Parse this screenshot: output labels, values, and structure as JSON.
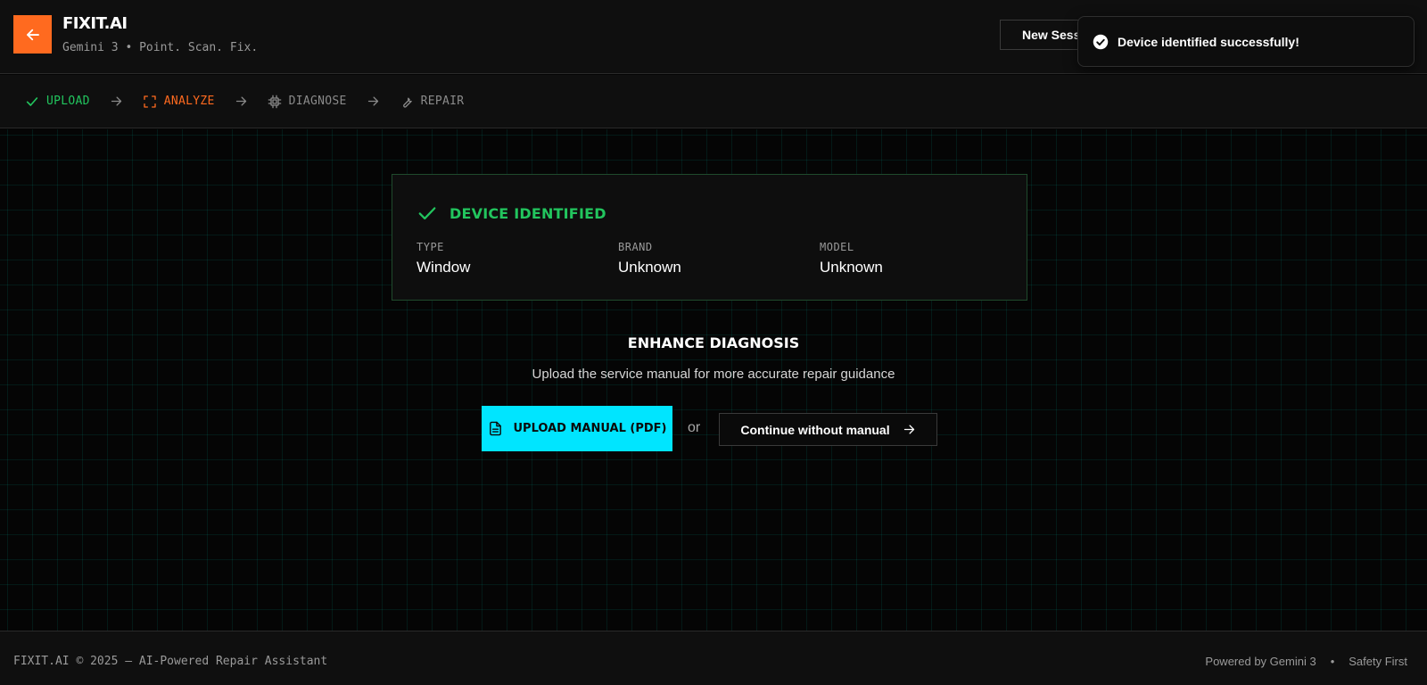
{
  "header": {
    "title": "FIXIT.AI",
    "subtitle": "Gemini 3 • Point. Scan. Fix.",
    "new_session_label": "New Session",
    "icons": {
      "back": "arrow-left-icon",
      "refresh": "refresh-icon"
    }
  },
  "toast": {
    "message": "Device identified successfully!",
    "icon": "check-circle-icon"
  },
  "steps": [
    {
      "label": "UPLOAD",
      "state": "done",
      "icon": "check-icon"
    },
    {
      "label": "ANALYZE",
      "state": "active",
      "icon": "scan-icon"
    },
    {
      "label": "DIAGNOSE",
      "state": "idle",
      "icon": "chip-icon"
    },
    {
      "label": "REPAIR",
      "state": "idle",
      "icon": "wrench-icon"
    }
  ],
  "device_card": {
    "title": "DEVICE IDENTIFIED",
    "fields": [
      {
        "key": "TYPE",
        "value": "Window"
      },
      {
        "key": "BRAND",
        "value": "Unknown"
      },
      {
        "key": "MODEL",
        "value": "Unknown"
      }
    ]
  },
  "enhance": {
    "title": "ENHANCE DIAGNOSIS",
    "subtitle": "Upload the service manual for more accurate repair guidance",
    "upload_label": "UPLOAD MANUAL (PDF)",
    "or_label": "or",
    "continue_label": "Continue without manual"
  },
  "footer": {
    "left": "FIXIT.AI © 2025 — AI-Powered Repair Assistant",
    "powered": "Powered by Gemini 3",
    "separator": "•",
    "safety": "Safety First"
  },
  "colors": {
    "accent_orange": "#ff6a1f",
    "accent_green": "#22c55e",
    "accent_cyan": "#00e5ff",
    "background": "#050505"
  }
}
